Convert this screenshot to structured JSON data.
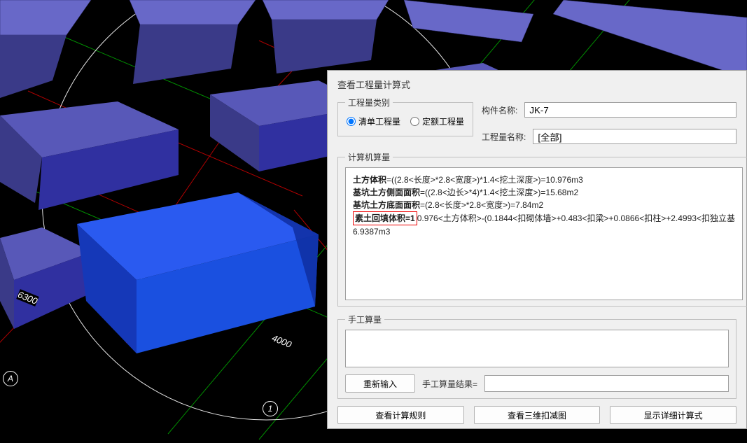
{
  "dialog": {
    "title": "查看工程量计算式",
    "category": {
      "legend": "工程量类别",
      "option1": "清单工程量",
      "option2": "定额工程量"
    },
    "fields": {
      "component_name_label": "构件名称:",
      "component_name_value": "JK-7",
      "quantity_name_label": "工程量名称:",
      "quantity_name_value": "[全部]"
    },
    "computer_calc": {
      "legend": "计算机算量",
      "line1_b": "土方体积",
      "line1_rest": "=((2.8<长度>*2.8<宽度>)*1.4<挖土深度>)=10.976m3",
      "line2_b": "基坑土方侧面面积",
      "line2_rest": "=((2.8<边长>*4)*1.4<挖土深度>)=15.68m2",
      "line3_b": "基坑土方底面面积",
      "line3_rest": "=(2.8<长度>*2.8<宽度>)=7.84m2",
      "line4_hl": "素土回填体积=1",
      "line4_rest": "0.976<土方体积>-(0.1844<扣砌体墙>+0.483<扣梁>+0.0866<扣柱>+2.4993<扣独立基",
      "line5": "6.9387m3"
    },
    "manual_calc": {
      "legend": "手工算量"
    },
    "buttons": {
      "reenter": "重新输入",
      "result_label": "手工算量结果=",
      "view_rules": "查看计算规则",
      "view_3d": "查看三维扣减图",
      "show_detail": "显示详细计算式"
    }
  },
  "viewport": {
    "dim1": "6300",
    "dim2": "4000",
    "grid_a": "A",
    "grid_1": "1"
  }
}
